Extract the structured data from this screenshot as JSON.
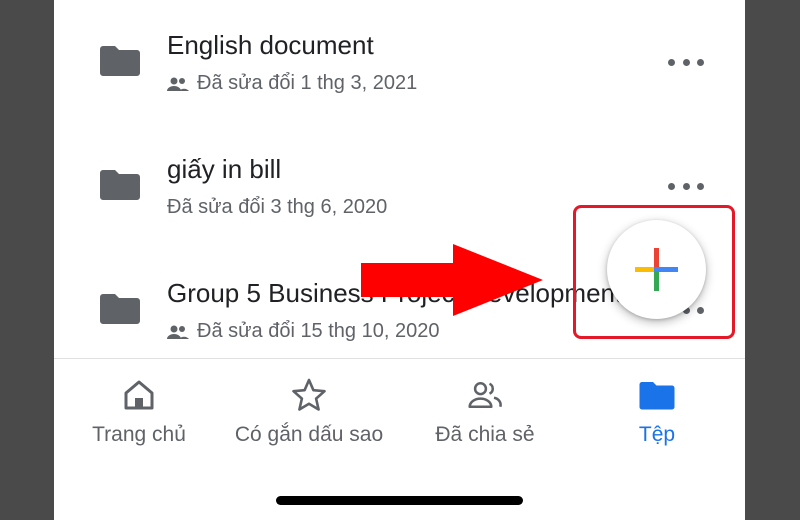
{
  "files": [
    {
      "name": "English document",
      "modified": "Đã sửa đổi 1 thg 3, 2021",
      "shared": true
    },
    {
      "name": "giấy in bill",
      "modified": "Đã sửa đổi 3 thg 6, 2020",
      "shared": false
    },
    {
      "name": "Group 5 Business Project Development",
      "modified": "Đã sửa đổi 15 thg 10, 2020",
      "shared": true
    }
  ],
  "nav": {
    "home": "Trang chủ",
    "starred": "Có gắn dấu sao",
    "shared": "Đã chia sẻ",
    "files": "Tệp",
    "active": "files"
  },
  "fab": {
    "icon": "plus-icon"
  },
  "annotation": {
    "arrow_color": "#ff0000",
    "box_color": "#e3192a"
  },
  "colors": {
    "accent": "#1a73e8",
    "folder": "#5f6368"
  }
}
